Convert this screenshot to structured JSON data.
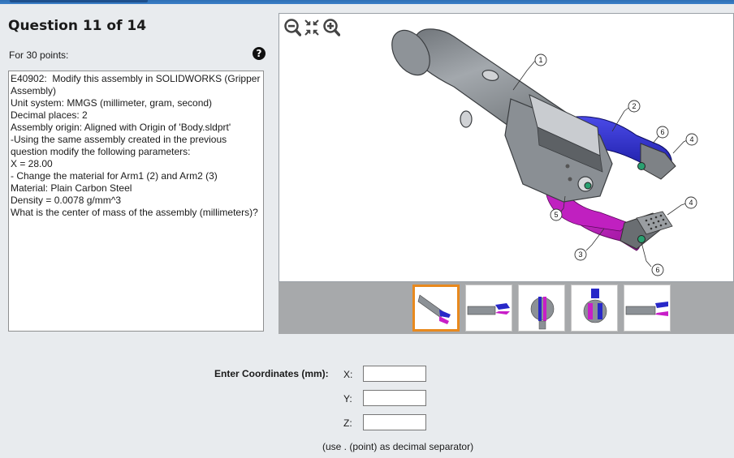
{
  "question": {
    "title": "Question 11 of 14",
    "points_label": "For 30 points:",
    "help_glyph": "?",
    "lines": [
      "E40902:  Modify this assembly in SOLIDWORKS (Gripper Assembly)",
      "",
      "Unit system: MMGS (millimeter, gram, second)",
      "Decimal places: 2",
      "Assembly origin: Aligned with Origin of 'Body.sldprt'",
      "",
      "-Using the same assembly created in the previous question modify the following parameters:",
      "",
      "X = 28.00",
      "",
      "- Change the material for Arm1 (2) and Arm2 (3)",
      "Material: Plain Carbon Steel",
      "Density = 0.0078 g/mm^3",
      "",
      "What is the center of mass of the assembly (millimeters)?"
    ]
  },
  "viewer": {
    "tools": [
      "zoom-out-icon",
      "fit-to-view-icon",
      "zoom-in-icon"
    ],
    "balloons": [
      "1",
      "2",
      "6",
      "4",
      "4",
      "5",
      "3",
      "6"
    ],
    "selected_thumbnail": 0,
    "thumbnail_count": 5
  },
  "answer": {
    "label": "Enter Coordinates (mm):",
    "x_label": "X:",
    "y_label": "Y:",
    "z_label": "Z:",
    "x_value": "",
    "y_value": "",
    "z_value": "",
    "note": "(use . (point) as decimal separator)"
  },
  "colors": {
    "body_gray": "#8c9196",
    "arm1_blue": "#2828c8",
    "arm2_magenta": "#c81ec8",
    "selected_thumb": "#e8891e"
  }
}
